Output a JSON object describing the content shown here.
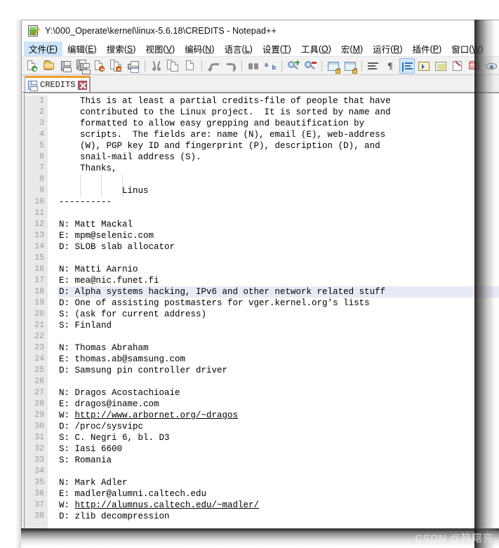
{
  "window": {
    "title": "Y:\\000_Operate\\kernel\\linux-5.6.18\\CREDITS - Notepad++",
    "app_icon": "notepad-plus-plus-icon"
  },
  "menubar": {
    "items": [
      {
        "label": "文件",
        "mnemonic": "F",
        "active": true
      },
      {
        "label": "编辑",
        "mnemonic": "E",
        "active": false
      },
      {
        "label": "搜索",
        "mnemonic": "S",
        "active": false
      },
      {
        "label": "视图",
        "mnemonic": "V",
        "active": false
      },
      {
        "label": "编码",
        "mnemonic": "N",
        "active": false
      },
      {
        "label": "语言",
        "mnemonic": "L",
        "active": false
      },
      {
        "label": "设置",
        "mnemonic": "T",
        "active": false
      },
      {
        "label": "工具",
        "mnemonic": "O",
        "active": false
      },
      {
        "label": "宏",
        "mnemonic": "M",
        "active": false
      },
      {
        "label": "运行",
        "mnemonic": "R",
        "active": false
      },
      {
        "label": "插件",
        "mnemonic": "P",
        "active": false
      },
      {
        "label": "窗口",
        "mnemonic": "W",
        "active": false
      }
    ]
  },
  "toolbar": {
    "icons": [
      "new-file-icon",
      "open-file-icon",
      "save-icon",
      "save-all-icon",
      "close-file-icon",
      "close-all-icon",
      "print-icon",
      "sep",
      "cut-icon",
      "copy-icon",
      "paste-icon",
      "sep",
      "undo-icon",
      "redo-icon",
      "sep",
      "find-icon",
      "replace-icon",
      "sep",
      "zoom-in-icon",
      "zoom-out-icon",
      "sep",
      "sync-vertical-scroll-icon",
      "sync-horizontal-scroll-icon",
      "sep",
      "word-wrap-icon",
      "show-all-characters-icon",
      "indent-guide-icon",
      "run-macro-icon",
      "show-document-map-icon",
      "function-list-icon",
      "folder-as-workspace-icon",
      "monitoring-icon"
    ],
    "selected_icon": "indent-guide-icon"
  },
  "tab": {
    "label": "CREDITS",
    "modified_icon": "save-disk-icon",
    "close_icon": "close-icon",
    "accent_color": "#f09a2c"
  },
  "editor": {
    "current_line": 18,
    "current_line_color": "#e8eaf6",
    "first_line": 1,
    "last_line": 38,
    "lines": [
      {
        "n": 1,
        "text": "    This is at least a partial credits-file of people that have"
      },
      {
        "n": 2,
        "text": "    contributed to the Linux project.  It is sorted by name and"
      },
      {
        "n": 3,
        "text": "    formatted to allow easy grepping and beautification by"
      },
      {
        "n": 4,
        "text": "    scripts.  The fields are: name (N), email (E), web-address"
      },
      {
        "n": 5,
        "text": "    (W), PGP key ID and fingerprint (P), description (D), and"
      },
      {
        "n": 6,
        "text": "    snail-mail address (S)."
      },
      {
        "n": 7,
        "text": "    Thanks,"
      },
      {
        "n": 8,
        "text": ""
      },
      {
        "n": 9,
        "text": "            Linus"
      },
      {
        "n": 10,
        "text": "----------"
      },
      {
        "n": 11,
        "text": ""
      },
      {
        "n": 12,
        "text": "N: Matt Mackal"
      },
      {
        "n": 13,
        "text": "E: mpm@selenic.com"
      },
      {
        "n": 14,
        "text": "D: SLOB slab allocator"
      },
      {
        "n": 15,
        "text": ""
      },
      {
        "n": 16,
        "text": "N: Matti Aarnio"
      },
      {
        "n": 17,
        "text": "E: mea@nic.funet.fi"
      },
      {
        "n": 18,
        "text": "D: Alpha systems hacking, IPv6 and other network related stuff"
      },
      {
        "n": 19,
        "text": "D: One of assisting postmasters for vger.kernel.org's lists"
      },
      {
        "n": 20,
        "text": "S: (ask for current address)"
      },
      {
        "n": 21,
        "text": "S: Finland"
      },
      {
        "n": 22,
        "text": ""
      },
      {
        "n": 23,
        "text": "N: Thomas Abraham"
      },
      {
        "n": 24,
        "text": "E: thomas.ab@samsung.com"
      },
      {
        "n": 25,
        "text": "D: Samsung pin controller driver"
      },
      {
        "n": 26,
        "text": ""
      },
      {
        "n": 27,
        "text": "N: Dragos Acostachioaie"
      },
      {
        "n": 28,
        "text": "E: dragos@iname.com"
      },
      {
        "n": 29,
        "text": "W: ",
        "link": "http://www.arbornet.org/~dragos"
      },
      {
        "n": 30,
        "text": "D: /proc/sysvipc"
      },
      {
        "n": 31,
        "text": "S: C. Negri 6, bl. D3"
      },
      {
        "n": 32,
        "text": "S: Iasi 6600"
      },
      {
        "n": 33,
        "text": "S: Romania"
      },
      {
        "n": 34,
        "text": ""
      },
      {
        "n": 35,
        "text": "N: Mark Adler"
      },
      {
        "n": 36,
        "text": "E: madler@alumni.caltech.edu"
      },
      {
        "n": 37,
        "text": "W: ",
        "link": "http://alumnus.caltech.edu/~madler/"
      },
      {
        "n": 38,
        "text": "D: zlib decompression"
      }
    ]
  },
  "watermark": {
    "text": "CSDN @韩曙亮"
  }
}
